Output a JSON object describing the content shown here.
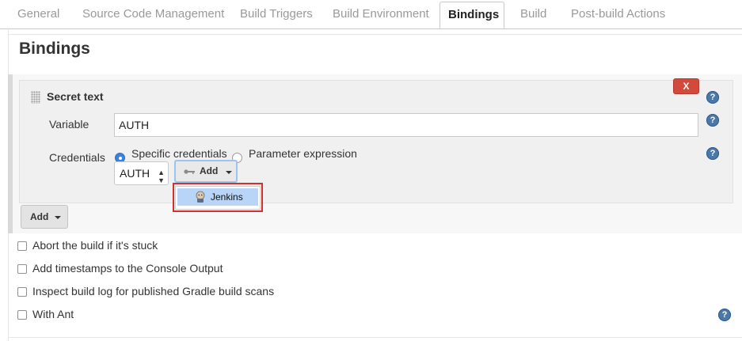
{
  "tabs": [
    {
      "label": "General"
    },
    {
      "label": "Source Code Management"
    },
    {
      "label": "Build Triggers"
    },
    {
      "label": "Build Environment"
    },
    {
      "label": "Bindings",
      "active": true
    },
    {
      "label": "Build"
    },
    {
      "label": "Post-build Actions"
    }
  ],
  "section": {
    "title": "Bindings"
  },
  "binding": {
    "title": "Secret text",
    "delete_label": "X",
    "variable": {
      "label": "Variable",
      "value": "AUTH"
    },
    "credentials": {
      "label": "Credentials",
      "options": [
        "Specific credentials",
        "Parameter expression"
      ],
      "selected_option": "Specific credentials",
      "select_value": "AUTH",
      "add_label": "Add",
      "menu_items": [
        "Jenkins"
      ]
    }
  },
  "add_binding_label": "Add",
  "help_symbol": "?",
  "options": [
    {
      "label": "Abort the build if it's stuck",
      "checked": false
    },
    {
      "label": "Add timestamps to the Console Output",
      "checked": false
    },
    {
      "label": "Inspect build log for published Gradle build scans",
      "checked": false
    },
    {
      "label": "With Ant",
      "checked": false
    }
  ],
  "colors": {
    "delete": "#d24a3c",
    "highlight": "#d32f2f",
    "help": "#4a78a8",
    "radio": "#3b82e0"
  },
  "icons": [
    "help-icon",
    "key-icon",
    "jenkins-icon",
    "drag-handle-icon",
    "caret-down-icon"
  ]
}
